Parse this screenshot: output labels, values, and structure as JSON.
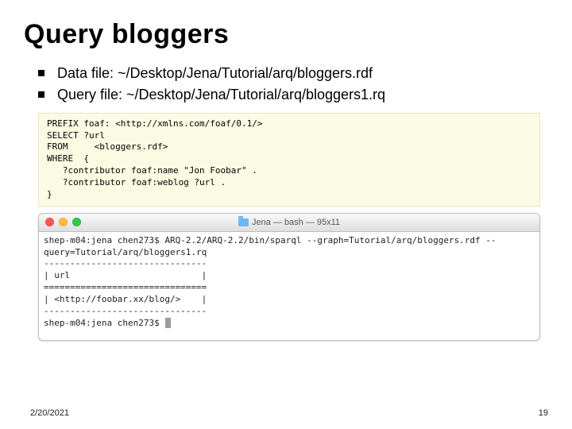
{
  "title": "Query bloggers",
  "bullets": [
    "Data file: ~/Desktop/Jena/Tutorial/arq/bloggers.rdf",
    "Query file: ~/Desktop/Jena/Tutorial/arq/bloggers1.rq"
  ],
  "sparql_code": "PREFIX foaf: <http://xmlns.com/foaf/0.1/>\nSELECT ?url\nFROM     <bloggers.rdf>\nWHERE  {\n   ?contributor foaf:name \"Jon Foobar\" .\n   ?contributor foaf:weblog ?url .\n}",
  "terminal": {
    "title": "Jena — bash — 95x11",
    "lines": "shep-m04:jena chen273$ ARQ-2.2/ARQ-2.2/bin/sparql --graph=Tutorial/arq/bloggers.rdf --\nquery=Tutorial/arq/bloggers1.rq\n-------------------------------\n| url                         |\n===============================\n| <http://foobar.xx/blog/>    |\n-------------------------------",
    "prompt_after": "shep-m04:jena chen273$ "
  },
  "footer": {
    "date": "2/20/2021",
    "page": "19"
  }
}
